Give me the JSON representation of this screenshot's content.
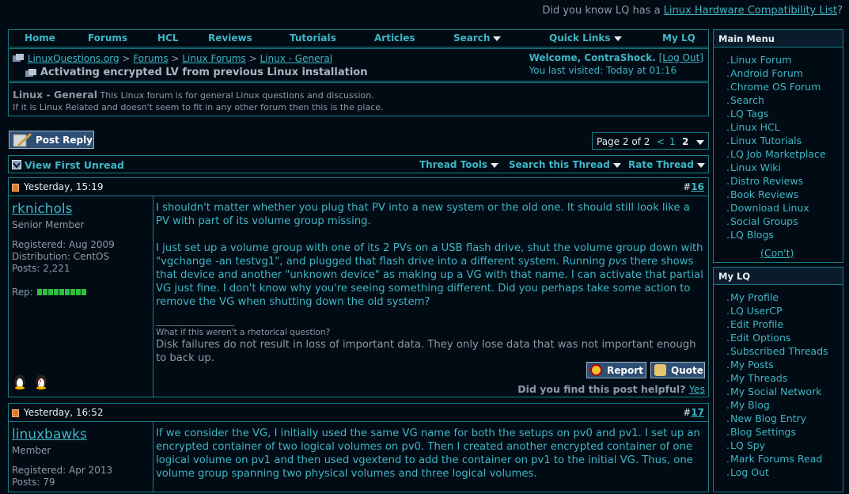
{
  "banner": {
    "prefix": "Did you know LQ has a ",
    "link": "Linux Hardware Compatibility List",
    "suffix": "?"
  },
  "navbar": {
    "items": [
      "Home",
      "Forums",
      "HCL",
      "Reviews",
      "Tutorials",
      "Articles",
      "Search",
      "Quick Links",
      "My LQ"
    ]
  },
  "breadcrumb": {
    "items": [
      "LinuxQuestions.org",
      "Forums",
      "Linux Forums",
      "Linux - General"
    ],
    "separator": ">",
    "thread_title": "Activating encrypted LV from previous Linux installation"
  },
  "welcome": {
    "label": "Welcome, ContraShock.",
    "logout": "[Log Out]",
    "last_visited": "You last visited: Today at 01:16"
  },
  "forum_desc": {
    "name": "Linux - General",
    "line1": "This Linux forum is for general Linux questions and discussion.",
    "line2": "If it is Linux Related and doesn't seem to fit in any other forum then this is the place."
  },
  "post_reply_label": "Post Reply",
  "pager": {
    "label": "Page 2 of 2",
    "prev": "<",
    "page1": "1",
    "page2": "2"
  },
  "toolsbar": {
    "first_unread": "View First Unread",
    "thread_tools": "Thread Tools",
    "search_thread": "Search this Thread",
    "rate_thread": "Rate Thread"
  },
  "posts": [
    {
      "date": "Yesterday, 15:19",
      "number": "16",
      "username": "rknichols",
      "title": "Senior Member",
      "registered": "Registered: Aug 2009",
      "distribution": "Distribution: CentOS",
      "posts": "Posts: 2,221",
      "rep_label": "Rep:",
      "p1": "I shouldn't matter whether you plug that PV into a new system or the old one. It should still look like a PV with part of its volume group missing.",
      "p2a": "I just set up a volume group with one of its 2 PVs on a USB flash drive, shut the volume group down with \"vgchange -an testvg1\", and plugged that flash drive into a different system. Running ",
      "p2cmd": "pvs",
      "p2b": " there shows that device and another \"unknown device\" as making up a VG with that name. I can activate that partial VG just fine. I don't know why you're seeing something different. Did you perhaps take some action to remove the VG when shutting down the old system?",
      "sig_line": "__________________",
      "sig_small": "What if this weren't a rhetorical question?",
      "sig_text": "Disk failures do not result in loss of important data. They only lose data that was not important enough to back up.",
      "report": "Report",
      "quote": "Quote",
      "helpful": "Did you find this post helpful?",
      "yes": "Yes"
    },
    {
      "date": "Yesterday, 16:52",
      "number": "17",
      "username": "linuxbawks",
      "title": "Member",
      "registered": "Registered: Apr 2013",
      "posts": "Posts: 79",
      "p1": "If we consider the VG, I initially used the same VG name for both the setups on pv0 and pv1. I set up an encrypted container of two logical volumes on pv0. Then I created another encrypted container of one logical volume on pv1 and then used vgextend to add the container on pv1 to the initial VG. Thus, one volume group spanning two physical volumes and three logical volumes."
    }
  ],
  "main_menu": {
    "title": "Main Menu",
    "items": [
      "Linux Forum",
      "Android Forum",
      "Chrome OS Forum",
      "Search",
      "LQ Tags",
      "Linux HCL",
      "Linux Tutorials",
      "LQ Job Marketplace",
      "Linux Wiki",
      "Distro Reviews",
      "Book Reviews",
      "Download Linux",
      "Social Groups",
      "LQ Blogs"
    ],
    "more": "(Con't)"
  },
  "my_lq": {
    "title": "My LQ",
    "items": [
      "My Profile",
      "LQ UserCP",
      "Edit Profile",
      "Edit Options",
      "Subscribed Threads",
      "My Posts",
      "My Threads",
      "My Social Network",
      "My Blog",
      "New Blog Entry",
      "Blog Settings",
      "LQ Spy",
      "Mark Forums Read",
      "Log Out"
    ]
  },
  "colors": {
    "accent": "#3fb6c6",
    "border": "#187d87",
    "background": "#000b14",
    "button": "#2d4f73"
  }
}
